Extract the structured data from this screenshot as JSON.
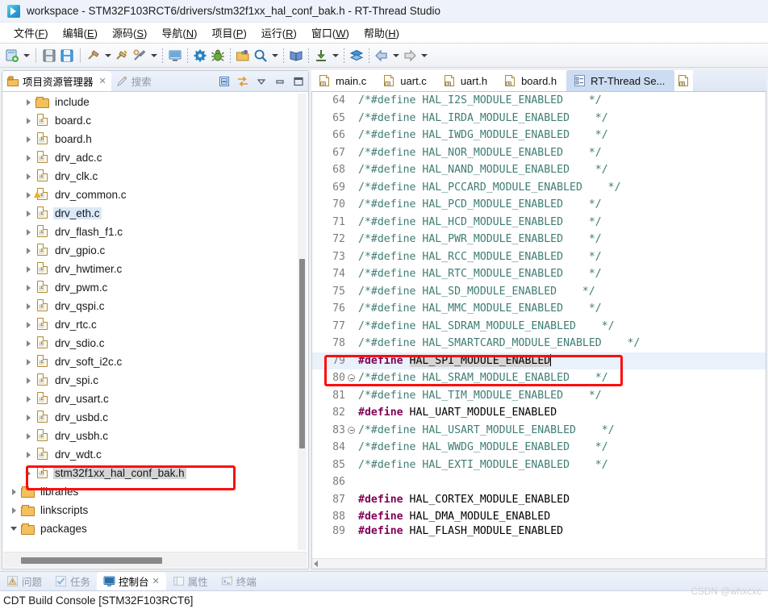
{
  "window": {
    "title": "workspace - STM32F103RCT6/drivers/stm32f1xx_hal_conf_bak.h - RT-Thread Studio",
    "logo_icon": "rt-thread-studio-logo-icon"
  },
  "menubar": {
    "items": [
      {
        "label": "文件",
        "accel": "F"
      },
      {
        "label": "编辑",
        "accel": "E"
      },
      {
        "label": "源码",
        "accel": "S"
      },
      {
        "label": "导航",
        "accel": "N"
      },
      {
        "label": "项目",
        "accel": "P"
      },
      {
        "label": "运行",
        "accel": "R"
      },
      {
        "label": "窗口",
        "accel": "W"
      },
      {
        "label": "帮助",
        "accel": "H"
      }
    ]
  },
  "toolbar": {
    "items": [
      {
        "icon": "new-project-icon",
        "dropdown": true
      },
      {
        "sep": true
      },
      {
        "icon": "save-icon",
        "dropdown": false
      },
      {
        "icon": "save-all-icon",
        "dropdown": false
      },
      {
        "sep": true
      },
      {
        "icon": "build-hammer-icon",
        "dropdown": true
      },
      {
        "icon": "clean-hammer-icon",
        "dropdown": false
      },
      {
        "icon": "build-config-icon",
        "dropdown": true
      },
      {
        "dots": true
      },
      {
        "icon": "open-perspective-icon",
        "dropdown": false
      },
      {
        "dots": true
      },
      {
        "icon": "settings-gear-icon",
        "dropdown": false
      },
      {
        "icon": "debug-bug-icon",
        "dropdown": false
      },
      {
        "dots": true
      },
      {
        "icon": "open-resource-folder-icon",
        "dropdown": false
      },
      {
        "icon": "search-magnifier-icon",
        "dropdown": true
      },
      {
        "dots": true
      },
      {
        "icon": "sdk-manager-book-icon",
        "dropdown": false
      },
      {
        "dots": true
      },
      {
        "icon": "download-flash-icon",
        "dropdown": true
      },
      {
        "dots": true
      },
      {
        "icon": "layers-icon",
        "dropdown": false
      },
      {
        "dots": true
      },
      {
        "icon": "back-arrow-icon",
        "dropdown": true
      },
      {
        "icon": "forward-arrow-icon",
        "dropdown": true
      }
    ]
  },
  "left_panel": {
    "tabs": [
      {
        "label": "项目资源管理器",
        "icon": "project-explorer-icon",
        "active": true,
        "closable": true
      },
      {
        "label": "搜索",
        "icon": "search-pencil-icon",
        "active": false,
        "closable": false
      }
    ],
    "tools": [
      {
        "icon": "collapse-all-icon"
      },
      {
        "icon": "link-with-editor-icon"
      },
      {
        "icon": "view-menu-chevron-down-icon"
      },
      {
        "icon": "minimize-icon"
      },
      {
        "icon": "maximize-icon"
      }
    ],
    "tree": [
      {
        "label": "include",
        "icon": "folder-icon",
        "indent": 2,
        "twisty": "right"
      },
      {
        "label": "board.c",
        "icon": "c-file-icon",
        "ext": "c",
        "indent": 2,
        "twisty": "right"
      },
      {
        "label": "board.h",
        "icon": "h-file-icon",
        "ext": "h",
        "indent": 2,
        "twisty": "right"
      },
      {
        "label": "drv_adc.c",
        "icon": "c-file-icon",
        "ext": "c",
        "indent": 2,
        "twisty": "right"
      },
      {
        "label": "drv_clk.c",
        "icon": "c-file-icon",
        "ext": "c",
        "indent": 2,
        "twisty": "right"
      },
      {
        "label": "drv_common.c",
        "icon": "c-file-warning-icon",
        "ext": "c",
        "indent": 2,
        "twisty": "right",
        "warning": true
      },
      {
        "label": "drv_eth.c",
        "icon": "c-file-icon",
        "ext": "c",
        "indent": 2,
        "twisty": "right",
        "select": "blue"
      },
      {
        "label": "drv_flash_f1.c",
        "icon": "c-file-icon",
        "ext": "c",
        "indent": 2,
        "twisty": "right"
      },
      {
        "label": "drv_gpio.c",
        "icon": "c-file-icon",
        "ext": "c",
        "indent": 2,
        "twisty": "right"
      },
      {
        "label": "drv_hwtimer.c",
        "icon": "c-file-icon",
        "ext": "c",
        "indent": 2,
        "twisty": "right"
      },
      {
        "label": "drv_pwm.c",
        "icon": "c-file-icon",
        "ext": "c",
        "indent": 2,
        "twisty": "right"
      },
      {
        "label": "drv_qspi.c",
        "icon": "c-file-icon",
        "ext": "c",
        "indent": 2,
        "twisty": "right"
      },
      {
        "label": "drv_rtc.c",
        "icon": "c-file-icon",
        "ext": "c",
        "indent": 2,
        "twisty": "right"
      },
      {
        "label": "drv_sdio.c",
        "icon": "c-file-icon",
        "ext": "c",
        "indent": 2,
        "twisty": "right"
      },
      {
        "label": "drv_soft_i2c.c",
        "icon": "c-file-icon",
        "ext": "c",
        "indent": 2,
        "twisty": "right"
      },
      {
        "label": "drv_spi.c",
        "icon": "c-file-icon",
        "ext": "c",
        "indent": 2,
        "twisty": "right"
      },
      {
        "label": "drv_usart.c",
        "icon": "c-file-icon",
        "ext": "c",
        "indent": 2,
        "twisty": "right"
      },
      {
        "label": "drv_usbd.c",
        "icon": "c-file-icon",
        "ext": "c",
        "indent": 2,
        "twisty": "right"
      },
      {
        "label": "drv_usbh.c",
        "icon": "c-file-icon",
        "ext": "c",
        "indent": 2,
        "twisty": "right"
      },
      {
        "label": "drv_wdt.c",
        "icon": "c-file-icon",
        "ext": "c",
        "indent": 2,
        "twisty": "right"
      },
      {
        "label": "stm32f1xx_hal_conf_bak.h",
        "icon": "h-file-icon",
        "ext": "h",
        "indent": 2,
        "twisty": "right",
        "select": "gray",
        "annotated": true
      },
      {
        "label": "libraries",
        "icon": "folder-icon",
        "indent": 1,
        "twisty": "right"
      },
      {
        "label": "linkscripts",
        "icon": "folder-icon",
        "indent": 1,
        "twisty": "right"
      },
      {
        "label": "packages",
        "icon": "folder-icon",
        "indent": 1,
        "twisty": "down"
      }
    ]
  },
  "editor": {
    "tabs": [
      {
        "label": "main.c",
        "icon": "c-file-icon",
        "ext": "c"
      },
      {
        "label": "uart.c",
        "icon": "c-file-icon",
        "ext": "c"
      },
      {
        "label": "uart.h",
        "icon": "h-file-icon",
        "ext": "h"
      },
      {
        "label": "board.h",
        "icon": "h-file-icon",
        "ext": "h"
      },
      {
        "label": "RT-Thread Se...",
        "icon": "rt-settings-icon",
        "ext": "",
        "selected": true
      },
      {
        "label": "",
        "icon": "h-file-icon",
        "ext": "h",
        "partial": true
      }
    ],
    "lines": [
      {
        "n": 64,
        "fold": false,
        "segs": [
          {
            "t": "/*#define HAL_I2S_MODULE_ENABLED    */",
            "c": "cmt"
          }
        ]
      },
      {
        "n": 65,
        "fold": false,
        "segs": [
          {
            "t": "/*#define HAL_IRDA_MODULE_ENABLED    */",
            "c": "cmt"
          }
        ]
      },
      {
        "n": 66,
        "fold": false,
        "segs": [
          {
            "t": "/*#define HAL_IWDG_MODULE_ENABLED    */",
            "c": "cmt"
          }
        ]
      },
      {
        "n": 67,
        "fold": false,
        "segs": [
          {
            "t": "/*#define HAL_NOR_MODULE_ENABLED    */",
            "c": "cmt"
          }
        ]
      },
      {
        "n": 68,
        "fold": false,
        "segs": [
          {
            "t": "/*#define HAL_NAND_MODULE_ENABLED    */",
            "c": "cmt"
          }
        ]
      },
      {
        "n": 69,
        "fold": false,
        "segs": [
          {
            "t": "/*#define HAL_PCCARD_MODULE_ENABLED    */",
            "c": "cmt"
          }
        ]
      },
      {
        "n": 70,
        "fold": false,
        "segs": [
          {
            "t": "/*#define HAL_PCD_MODULE_ENABLED    */",
            "c": "cmt"
          }
        ]
      },
      {
        "n": 71,
        "fold": false,
        "segs": [
          {
            "t": "/*#define HAL_HCD_MODULE_ENABLED    */",
            "c": "cmt"
          }
        ]
      },
      {
        "n": 72,
        "fold": false,
        "segs": [
          {
            "t": "/*#define HAL_PWR_MODULE_ENABLED    */",
            "c": "cmt"
          }
        ]
      },
      {
        "n": 73,
        "fold": false,
        "segs": [
          {
            "t": "/*#define HAL_RCC_MODULE_ENABLED    */",
            "c": "cmt"
          }
        ]
      },
      {
        "n": 74,
        "fold": false,
        "segs": [
          {
            "t": "/*#define HAL_RTC_MODULE_ENABLED    */",
            "c": "cmt"
          }
        ]
      },
      {
        "n": 75,
        "fold": false,
        "segs": [
          {
            "t": "/*#define HAL_SD_MODULE_ENABLED    */",
            "c": "cmt"
          }
        ]
      },
      {
        "n": 76,
        "fold": false,
        "segs": [
          {
            "t": "/*#define HAL_MMC_MODULE_ENABLED    */",
            "c": "cmt"
          }
        ]
      },
      {
        "n": 77,
        "fold": false,
        "segs": [
          {
            "t": "/*#define HAL_SDRAM_MODULE_ENABLED    */",
            "c": "cmt"
          }
        ]
      },
      {
        "n": 78,
        "fold": false,
        "segs": [
          {
            "t": "/*#define HAL_SMARTCARD_MODULE_ENABLED    */",
            "c": "cmt"
          }
        ]
      },
      {
        "n": 79,
        "fold": false,
        "current": true,
        "segs": [
          {
            "t": "#define",
            "c": "kw"
          },
          {
            "t": " ",
            "c": "ident"
          },
          {
            "t": "HAL_SPI_MODULE_ENABLED",
            "c": "occ"
          }
        ],
        "caret": true
      },
      {
        "n": 80,
        "fold": true,
        "segs": [
          {
            "t": "/*#define HAL_SRAM_MODULE_ENABLED    */",
            "c": "cmt"
          }
        ]
      },
      {
        "n": 81,
        "fold": false,
        "segs": [
          {
            "t": "/*#define HAL_TIM_MODULE_ENABLED    */",
            "c": "cmt"
          }
        ]
      },
      {
        "n": 82,
        "fold": false,
        "segs": [
          {
            "t": "#define",
            "c": "kw"
          },
          {
            "t": " HAL_UART_MODULE_ENABLED",
            "c": "ident"
          }
        ]
      },
      {
        "n": 83,
        "fold": true,
        "segs": [
          {
            "t": "/*#define HAL_USART_MODULE_ENABLED    */",
            "c": "cmt"
          }
        ]
      },
      {
        "n": 84,
        "fold": false,
        "segs": [
          {
            "t": "/*#define HAL_WWDG_MODULE_ENABLED    */",
            "c": "cmt"
          }
        ]
      },
      {
        "n": 85,
        "fold": false,
        "segs": [
          {
            "t": "/*#define HAL_EXTI_MODULE_ENABLED    */",
            "c": "cmt"
          }
        ]
      },
      {
        "n": 86,
        "fold": false,
        "segs": [
          {
            "t": "",
            "c": "ident"
          }
        ]
      },
      {
        "n": 87,
        "fold": false,
        "segs": [
          {
            "t": "#define",
            "c": "kw"
          },
          {
            "t": " HAL_CORTEX_MODULE_ENABLED",
            "c": "ident"
          }
        ]
      },
      {
        "n": 88,
        "fold": false,
        "segs": [
          {
            "t": "#define",
            "c": "kw"
          },
          {
            "t": " HAL_DMA_MODULE_ENABLED",
            "c": "ident"
          }
        ]
      },
      {
        "n": 89,
        "fold": false,
        "clipped": true,
        "segs": [
          {
            "t": "#define",
            "c": "kw"
          },
          {
            "t": " HAL_FLASH_MODULE_ENABLED",
            "c": "ident"
          }
        ]
      }
    ]
  },
  "bottom_panel": {
    "tabs": [
      {
        "label": "问题",
        "icon": "problems-icon",
        "active": false,
        "closable": false
      },
      {
        "label": "任务",
        "icon": "tasks-icon",
        "active": false,
        "closable": false
      },
      {
        "label": "控制台",
        "icon": "console-icon",
        "active": true,
        "closable": true
      },
      {
        "label": "属性",
        "icon": "properties-icon",
        "active": false,
        "closable": false
      },
      {
        "label": "终端",
        "icon": "terminal-icon",
        "active": false,
        "closable": false
      }
    ],
    "console_title": "CDT Build Console [STM32F103RCT6]"
  },
  "watermark": "CSDN @whxcxc",
  "colors": {
    "annotation_red": "#fd0d0d",
    "comment_green": "#3f7d74",
    "keyword_purple": "#7f0055",
    "occurrence_gray": "#d4d4d4",
    "current_line_blue": "#e9f1fb",
    "selection_gray": "#d4d4d4",
    "selection_blue": "#dbe8f7"
  }
}
